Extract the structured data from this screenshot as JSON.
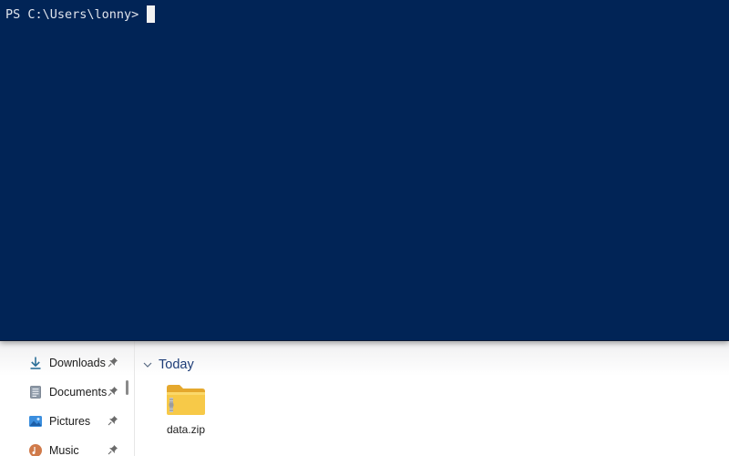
{
  "terminal": {
    "prompt": "PS C:\\Users\\lonny>",
    "background_color": "#012456",
    "text_color": "#e0e4ec"
  },
  "explorer": {
    "nav_items": [
      {
        "label": "Downloads",
        "icon": "download-icon",
        "pinned": true
      },
      {
        "label": "Documents",
        "icon": "document-icon",
        "pinned": true
      },
      {
        "label": "Pictures",
        "icon": "picture-icon",
        "pinned": true
      },
      {
        "label": "Music",
        "icon": "music-icon",
        "pinned": true
      }
    ],
    "group": {
      "label": "Today",
      "icon": "chevron-down-icon"
    },
    "files": [
      {
        "name": "data.zip",
        "icon": "zip-folder-icon"
      }
    ]
  }
}
